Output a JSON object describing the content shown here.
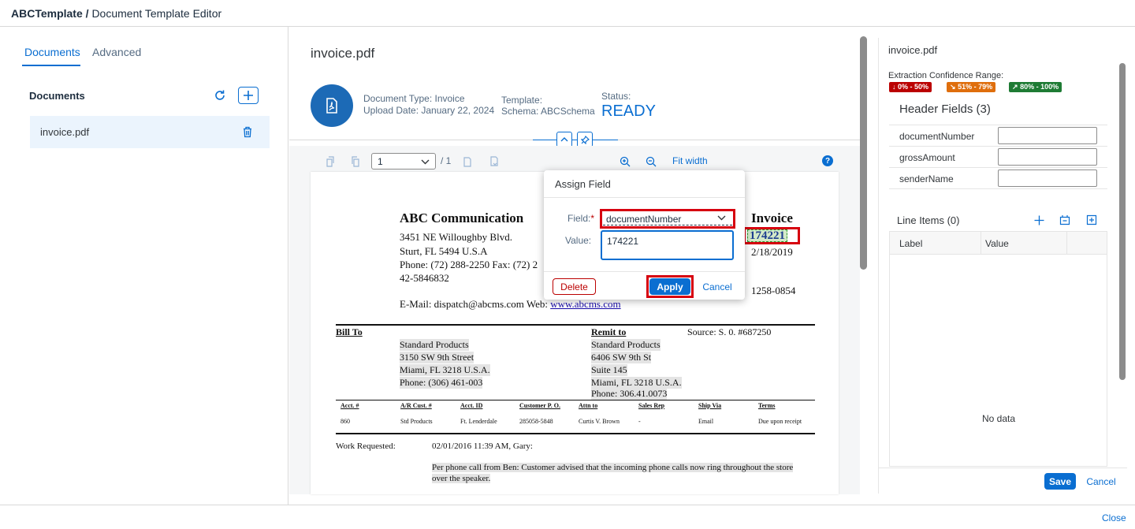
{
  "app": {
    "product": "ABCTemplate",
    "separator": " / ",
    "title": "Document Template Editor"
  },
  "left_panel": {
    "tabs": [
      {
        "label": "Documents",
        "active": true
      },
      {
        "label": "Advanced",
        "active": false
      }
    ],
    "section_title": "Documents",
    "documents": [
      {
        "name": "invoice.pdf",
        "selected": true
      }
    ]
  },
  "center_panel": {
    "file_title": "invoice.pdf",
    "doc_type": "Document Type: Invoice",
    "upload_date": "Upload Date: January 22, 2024",
    "template_label": "Template:",
    "schema": "Schema: ABCSchema",
    "status_label": "Status:",
    "status_value": "READY",
    "toolbar": {
      "page_value": "1",
      "page_total": "/ 1",
      "fit_width": "Fit width"
    }
  },
  "pdf": {
    "company": "ABC Communication",
    "address1": "3451 NE Willoughby Blvd.",
    "address2": "Sturt, FL 5494 U.S.A",
    "phone": "Phone: (72) 288-2250   Fax: (72) 2",
    "code": "42-5846832",
    "email": "E-Mail: dispatch@abcms.com Web: ",
    "web": "www.abcms.com",
    "invoice_heading": "Invoice",
    "invoice_number": "174221",
    "invoice_date": "2/18/2019",
    "invoice_ref": "1258-0854",
    "bill_to_label": "Bill To",
    "bill_to": [
      "Standard Products",
      "3150 SW 9th Street",
      "Miami, FL 3218 U.S.A.",
      "Phone: (306) 461-003"
    ],
    "remit_to_label": "Remit to",
    "remit_to": [
      "Standard Products",
      "6406 SW 9th St",
      "Suite 145",
      "Miami, FL 3218 U.S.A.",
      "Phone: 306.41.0073"
    ],
    "source": "Source: S. 0. #687250",
    "table_headers": [
      "Acct. #",
      "A/R Cust. #",
      "Acct. ID",
      "Customer P. O.",
      "Attn to",
      "Sales Rep",
      "Ship Via",
      "Terms"
    ],
    "table_row": [
      "860",
      "Std Products",
      "Ft. Lenderdale",
      "285058-5848",
      "Curtis V. Brown",
      "-",
      "Email",
      "Due upon receipt"
    ],
    "work_requested_label": "Work Requested:",
    "work_requested_date": "02/01/2016 11:39 AM, Gary:",
    "work_line1": "Per phone call from Ben: Customer advised that the incoming phone calls now ring throughout the store",
    "work_line2": "over the speaker."
  },
  "dialog": {
    "title": "Assign Field",
    "field_label": "Field:",
    "required_marker": "*",
    "field_value": "documentNumber",
    "value_label": "Value:",
    "value_text": "174221",
    "delete_label": "Delete",
    "apply_label": "Apply",
    "cancel_label": "Cancel"
  },
  "right_panel": {
    "file_title": "invoice.pdf",
    "confidence_label": "Extraction Confidence Range:",
    "badges": [
      {
        "label": "0% - 50%",
        "color": "#bb0000"
      },
      {
        "label": "51% - 79%",
        "color": "#df6e0c"
      },
      {
        "label": "80% - 100%",
        "color": "#1e7b34"
      }
    ],
    "header_fields_title": "Header Fields (3)",
    "header_fields": [
      "documentNumber",
      "grossAmount",
      "senderName"
    ],
    "line_items_title": "Line Items (0)",
    "columns": [
      "Label",
      "Value"
    ],
    "no_data": "No data",
    "save_label": "Save",
    "cancel_label": "Cancel"
  },
  "footer": {
    "close_label": "Close"
  },
  "colors": {
    "accent": "#0a6ed1",
    "highlight_border": "#d6000f"
  }
}
